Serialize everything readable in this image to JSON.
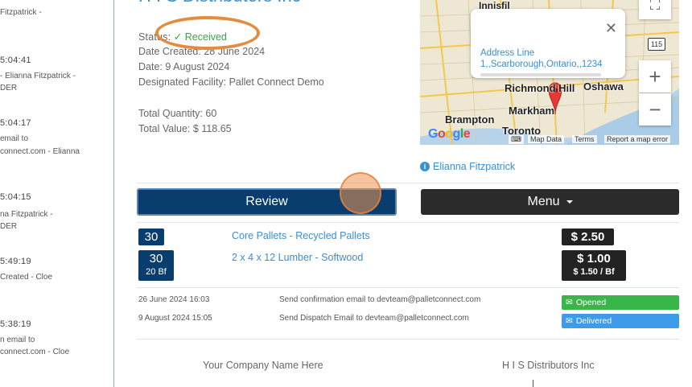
{
  "feed": [
    {
      "time": "",
      "lines": [
        "Fitzpatrick -"
      ]
    },
    {
      "time": "5:04:41",
      "lines": [
        "- Elianna Fitzpatrick -",
        "DER"
      ]
    },
    {
      "time": "5:04:17",
      "lines": [
        "email to",
        "connect.com - Elianna"
      ]
    },
    {
      "time": "5:04:15",
      "lines": [
        "na Fitzpatrick -",
        "DER"
      ]
    },
    {
      "time": "5:49:19",
      "lines": [
        "Created - Cloe"
      ]
    },
    {
      "time": "5:38:19",
      "lines": [
        "n email to",
        "connect.com - Cloe"
      ]
    }
  ],
  "header": {
    "title": "H I S Distributors Inc",
    "status_label": "Status:",
    "status_value": "Received",
    "date_created_label": "Date Created:",
    "date_created_value": "28 June 2024",
    "date_label": "Date:",
    "date_value": "9 August 2024",
    "facility_label": "Designated Facility:",
    "facility_value": "Pallet Connect Demo",
    "total_qty_label": "Total Quantity:",
    "total_qty_value": "60",
    "total_value_label": "Total Value:",
    "total_value_value": "$ 118.65"
  },
  "map": {
    "popup_line1": "Address Line",
    "popup_line2": "1,,Scarborough,Ontario,,1234",
    "cities": [
      "Innisfil",
      "Richmond Hill",
      "Oshawa",
      "Markham",
      "Brampton",
      "Toronto"
    ],
    "route_badge": "115",
    "google": "Google",
    "footer_map_data": "Map Data",
    "footer_terms": "Terms",
    "footer_report": "Report a map error"
  },
  "user_link": "Elianna Fitzpatrick",
  "buttons": {
    "review": "Review",
    "menu": "Menu"
  },
  "items": [
    {
      "qty": "30",
      "sub": "",
      "name": "Core Pallets - Recycled Pallets",
      "price": "$ 2.50",
      "price_sub": ""
    },
    {
      "qty": "30",
      "sub": "20 Bf",
      "name": "2 x 4 x 12 Lumber - Softwood",
      "price": "$ 1.00",
      "price_sub": "$ 1.50 / Bf"
    }
  ],
  "log": [
    {
      "date": "26 June 2024 16:03",
      "text": "Send confirmation email to devteam@palletconnect.com",
      "badge": "Opened",
      "color": "#39b54a"
    },
    {
      "date": "9 August 2024 15:05",
      "text": "Send Dispatch Email to devteam@palletconnect.com",
      "badge": "Delivered",
      "color": "#3d9be9"
    }
  ],
  "footer": {
    "left": "Your Company Name Here",
    "right": "H I S Distributors Inc"
  }
}
